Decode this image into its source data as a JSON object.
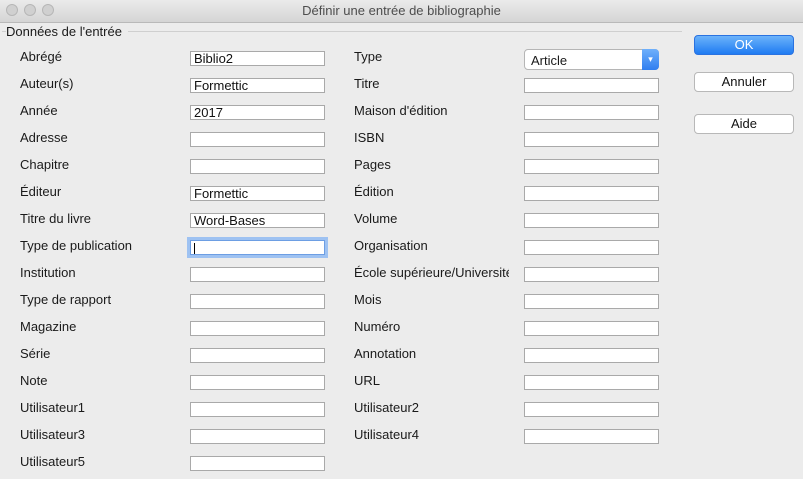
{
  "window": {
    "title": "Définir une entrée de bibliographie"
  },
  "group": {
    "label": "Données de l'entrée"
  },
  "left_fields": [
    {
      "label": "Abrégé",
      "value": "Biblio2"
    },
    {
      "label": "Auteur(s)",
      "value": "Formettic"
    },
    {
      "label": "Année",
      "value": "2017"
    },
    {
      "label": "Adresse",
      "value": ""
    },
    {
      "label": "Chapitre",
      "value": ""
    },
    {
      "label": "Éditeur",
      "value": "Formettic"
    },
    {
      "label": "Titre du livre",
      "value": "Word-Bases"
    },
    {
      "label": "Type de publication",
      "value": ""
    },
    {
      "label": "Institution",
      "value": ""
    },
    {
      "label": "Type de rapport",
      "value": ""
    },
    {
      "label": "Magazine",
      "value": ""
    },
    {
      "label": "Série",
      "value": ""
    },
    {
      "label": "Note",
      "value": ""
    },
    {
      "label": "Utilisateur1",
      "value": ""
    },
    {
      "label": "Utilisateur3",
      "value": ""
    },
    {
      "label": "Utilisateur5",
      "value": ""
    }
  ],
  "right_fields": [
    {
      "label": "Type",
      "value": "Article"
    },
    {
      "label": "Titre",
      "value": ""
    },
    {
      "label": "Maison d'édition",
      "value": ""
    },
    {
      "label": "ISBN",
      "value": ""
    },
    {
      "label": "Pages",
      "value": ""
    },
    {
      "label": "Édition",
      "value": ""
    },
    {
      "label": "Volume",
      "value": ""
    },
    {
      "label": "Organisation",
      "value": ""
    },
    {
      "label": "École supérieure/Université",
      "value": ""
    },
    {
      "label": "Mois",
      "value": ""
    },
    {
      "label": "Numéro",
      "value": ""
    },
    {
      "label": "Annotation",
      "value": ""
    },
    {
      "label": "URL",
      "value": ""
    },
    {
      "label": "Utilisateur2",
      "value": ""
    },
    {
      "label": "Utilisateur4",
      "value": ""
    }
  ],
  "buttons": {
    "ok": "OK",
    "cancel": "Annuler",
    "help": "Aide"
  },
  "colors": {
    "accent": "#1f7bf2",
    "focus_ring": "#9ec2f2"
  },
  "icons": {
    "select_arrow": "chevron-down-icon"
  }
}
